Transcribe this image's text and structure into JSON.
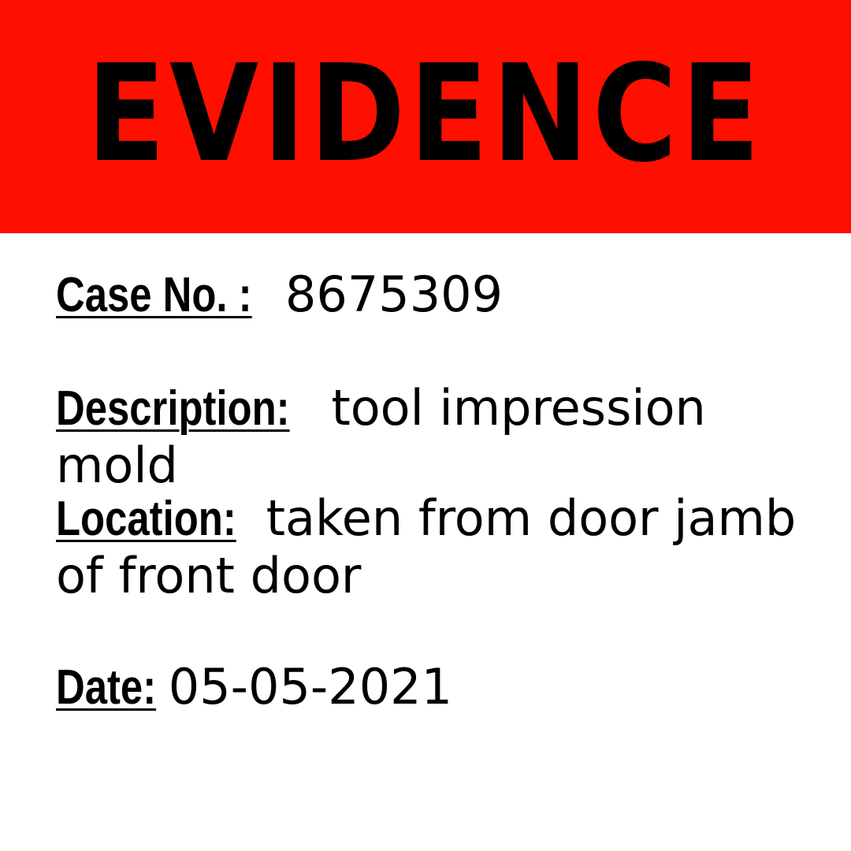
{
  "banner": {
    "title": "EVIDENCE",
    "background_color": "#ff0f00",
    "text_color": "#000000"
  },
  "fields": {
    "case_no": {
      "label": "Case No. :",
      "value": "8675309"
    },
    "description": {
      "label": "Description:",
      "value": "tool impression mold"
    },
    "location": {
      "label": "Location:",
      "value": "taken from door jamb of front door"
    },
    "date": {
      "label": "Date:",
      "value": "05-05-2021"
    }
  }
}
